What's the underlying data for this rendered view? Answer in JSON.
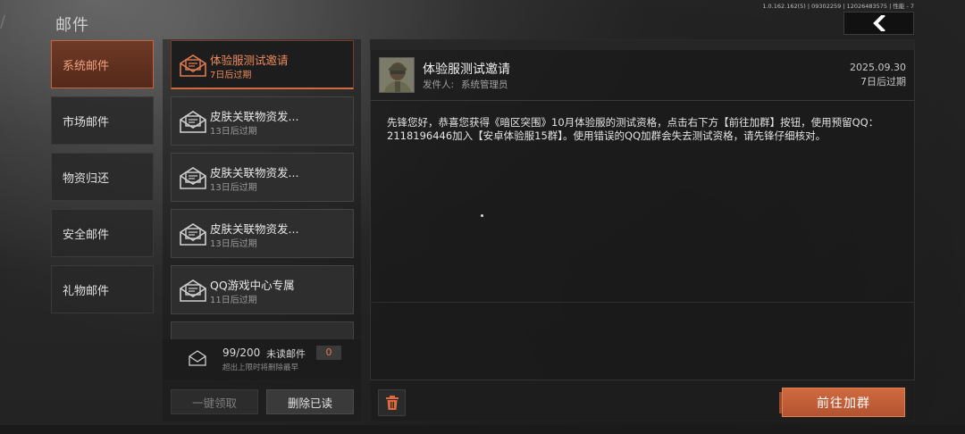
{
  "version": "1.0.162.162(5) | 09302259 | 12026483575 | 性能 - 7",
  "header": {
    "title": "邮件"
  },
  "categories": [
    {
      "label": "系统邮件"
    },
    {
      "label": "市场邮件"
    },
    {
      "label": "物资归还"
    },
    {
      "label": "安全邮件"
    },
    {
      "label": "礼物邮件"
    }
  ],
  "mails": [
    {
      "title": "体验服测试邀请",
      "expiry": "7日后过期"
    },
    {
      "title": "皮肤关联物资发...",
      "expiry": "13日后过期"
    },
    {
      "title": "皮肤关联物资发...",
      "expiry": "13日后过期"
    },
    {
      "title": "皮肤关联物资发...",
      "expiry": "13日后过期"
    },
    {
      "title": "QQ游戏中心专属",
      "expiry": "11日后过期"
    }
  ],
  "counter": {
    "count": "99/200",
    "unread_label": "未读邮件",
    "unread_count": "0",
    "note": "超出上限时将删除最早"
  },
  "actions": {
    "claim_all": "一键领取",
    "delete_read": "删除已读"
  },
  "detail": {
    "title": "体验服测试邀请",
    "sender_label": "发件人:",
    "sender": "系统管理员",
    "date": "2025.09.30",
    "expiry": "7日后过期",
    "body": "先锋您好，恭喜您获得《暗区突围》10月体验服的测试资格，点击右下方【前往加群】按钮，使用预留QQ：2118196446加入【安卓体验服15群】。使用错误的QQ加群会失去测试资格，请先锋仔细核对。",
    "join_button": "前往加群"
  },
  "colors": {
    "accent": "#d06a40",
    "accent_text": "#f08a5c"
  }
}
